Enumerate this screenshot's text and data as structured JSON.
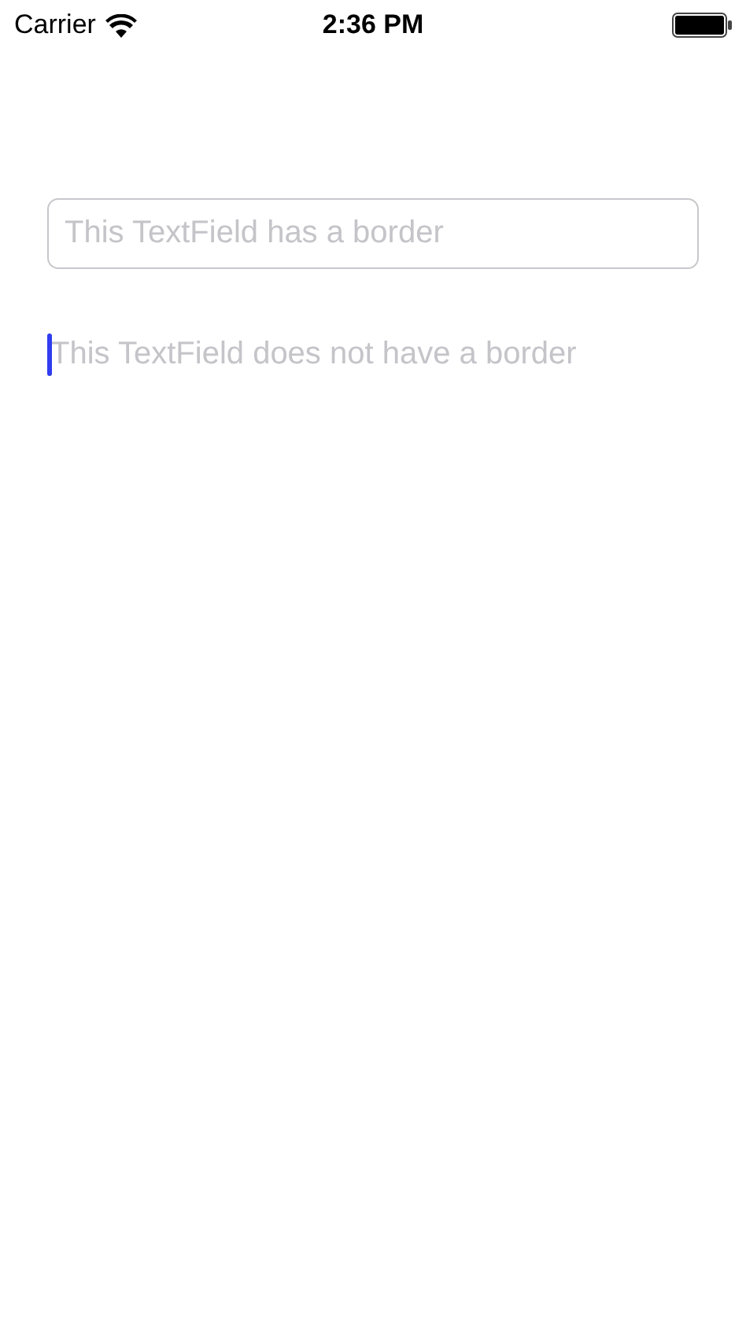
{
  "status_bar": {
    "carrier": "Carrier",
    "time": "2:36 PM"
  },
  "fields": [
    {
      "placeholder": "This TextField has a border",
      "bordered": true,
      "focused": false
    },
    {
      "placeholder": "This TextField does not have a border",
      "bordered": false,
      "focused": true
    }
  ]
}
